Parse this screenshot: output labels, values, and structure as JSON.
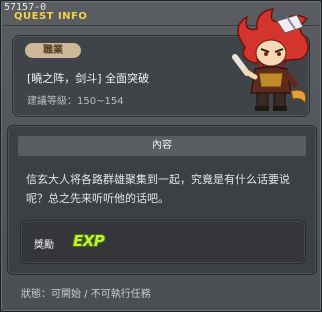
{
  "window": {
    "id": "57157-0",
    "title": "QUEST INFO"
  },
  "job": {
    "badge": "職業",
    "quest_name": "[曉之阵，剑斗] 全面突破",
    "level_requirement": "建議等級：150~154"
  },
  "content": {
    "header": "內容",
    "text": "信玄大人将各路群雄聚集到一起，究竟是有什么话要说呢？总之先来听听他的话吧。"
  },
  "reward": {
    "label": "獎勵",
    "icon_text": "EXP"
  },
  "status": {
    "text": "狀態：可開始 / 不可執行任務"
  },
  "colors": {
    "title": "#f4d245",
    "badge_bg": "#cdb99a",
    "exp": "#c6ef3a"
  },
  "icons": {
    "character": "red-haired-warrior-character",
    "exp": "exp-icon"
  }
}
